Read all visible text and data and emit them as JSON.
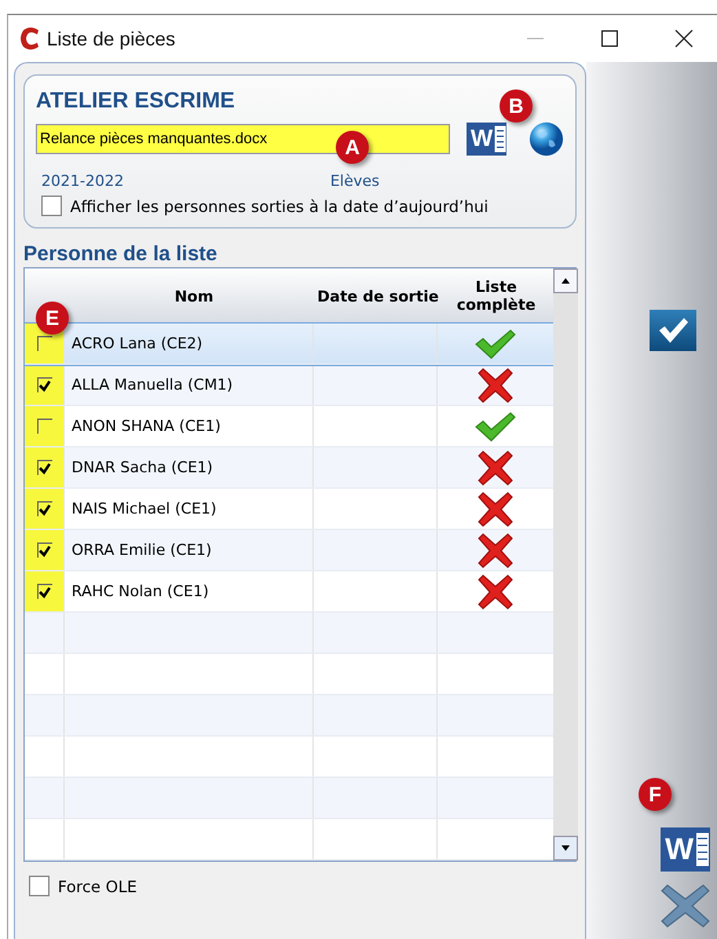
{
  "window": {
    "title": "Liste de pièces"
  },
  "header": {
    "title": "ATELIER ESCRIME",
    "document": "Relance pièces manquantes.docx",
    "word_label": "W",
    "year": "2021-2022",
    "category": "Elèves",
    "show_left": {
      "label": "Afficher les personnes sorties à la date d’aujourd’hui",
      "checked": false
    }
  },
  "list": {
    "title": "Personne de la liste",
    "columns": [
      "Nom",
      "Date de sortie",
      "Liste complète"
    ],
    "rows": [
      {
        "name": "ACRO Lana (CE2)",
        "checked": false,
        "complete": true,
        "selected": true
      },
      {
        "name": "ALLA Manuella (CM1)",
        "checked": true,
        "complete": false,
        "selected": false
      },
      {
        "name": "ANON SHANA (CE1)",
        "checked": false,
        "complete": true,
        "selected": false
      },
      {
        "name": "DNAR Sacha (CE1)",
        "checked": true,
        "complete": false,
        "selected": false
      },
      {
        "name": "NAIS Michael (CE1)",
        "checked": true,
        "complete": false,
        "selected": false
      },
      {
        "name": "ORRA Emilie (CE1)",
        "checked": true,
        "complete": false,
        "selected": false
      },
      {
        "name": "RAHC Nolan (CE1)",
        "checked": true,
        "complete": false,
        "selected": false
      }
    ]
  },
  "force_ole": {
    "label": "Force OLE",
    "checked": false
  },
  "sidebar": {
    "word_label": "W"
  },
  "callouts": [
    {
      "label": "A"
    },
    {
      "label": "B"
    },
    {
      "label": "E"
    },
    {
      "label": "F"
    }
  ]
}
